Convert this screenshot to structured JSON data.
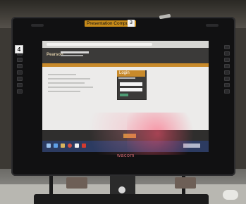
{
  "labels": {
    "computer_label": "Presentation Computer",
    "monitor_number": "3",
    "station_number": "4"
  },
  "monitor": {
    "brand": "wacom"
  },
  "screen": {
    "website": {
      "header_logo": "Pearson",
      "login_title": "Login"
    }
  },
  "colors": {
    "accent_orange": "#c88a2b",
    "taskbar_blue": "#2c3b61",
    "login_green": "#4f9b74"
  },
  "icons": [
    "windows-start-icon",
    "internet-explorer-icon",
    "file-explorer-icon",
    "chrome-icon",
    "app-icon",
    "acrobat-icon"
  ]
}
